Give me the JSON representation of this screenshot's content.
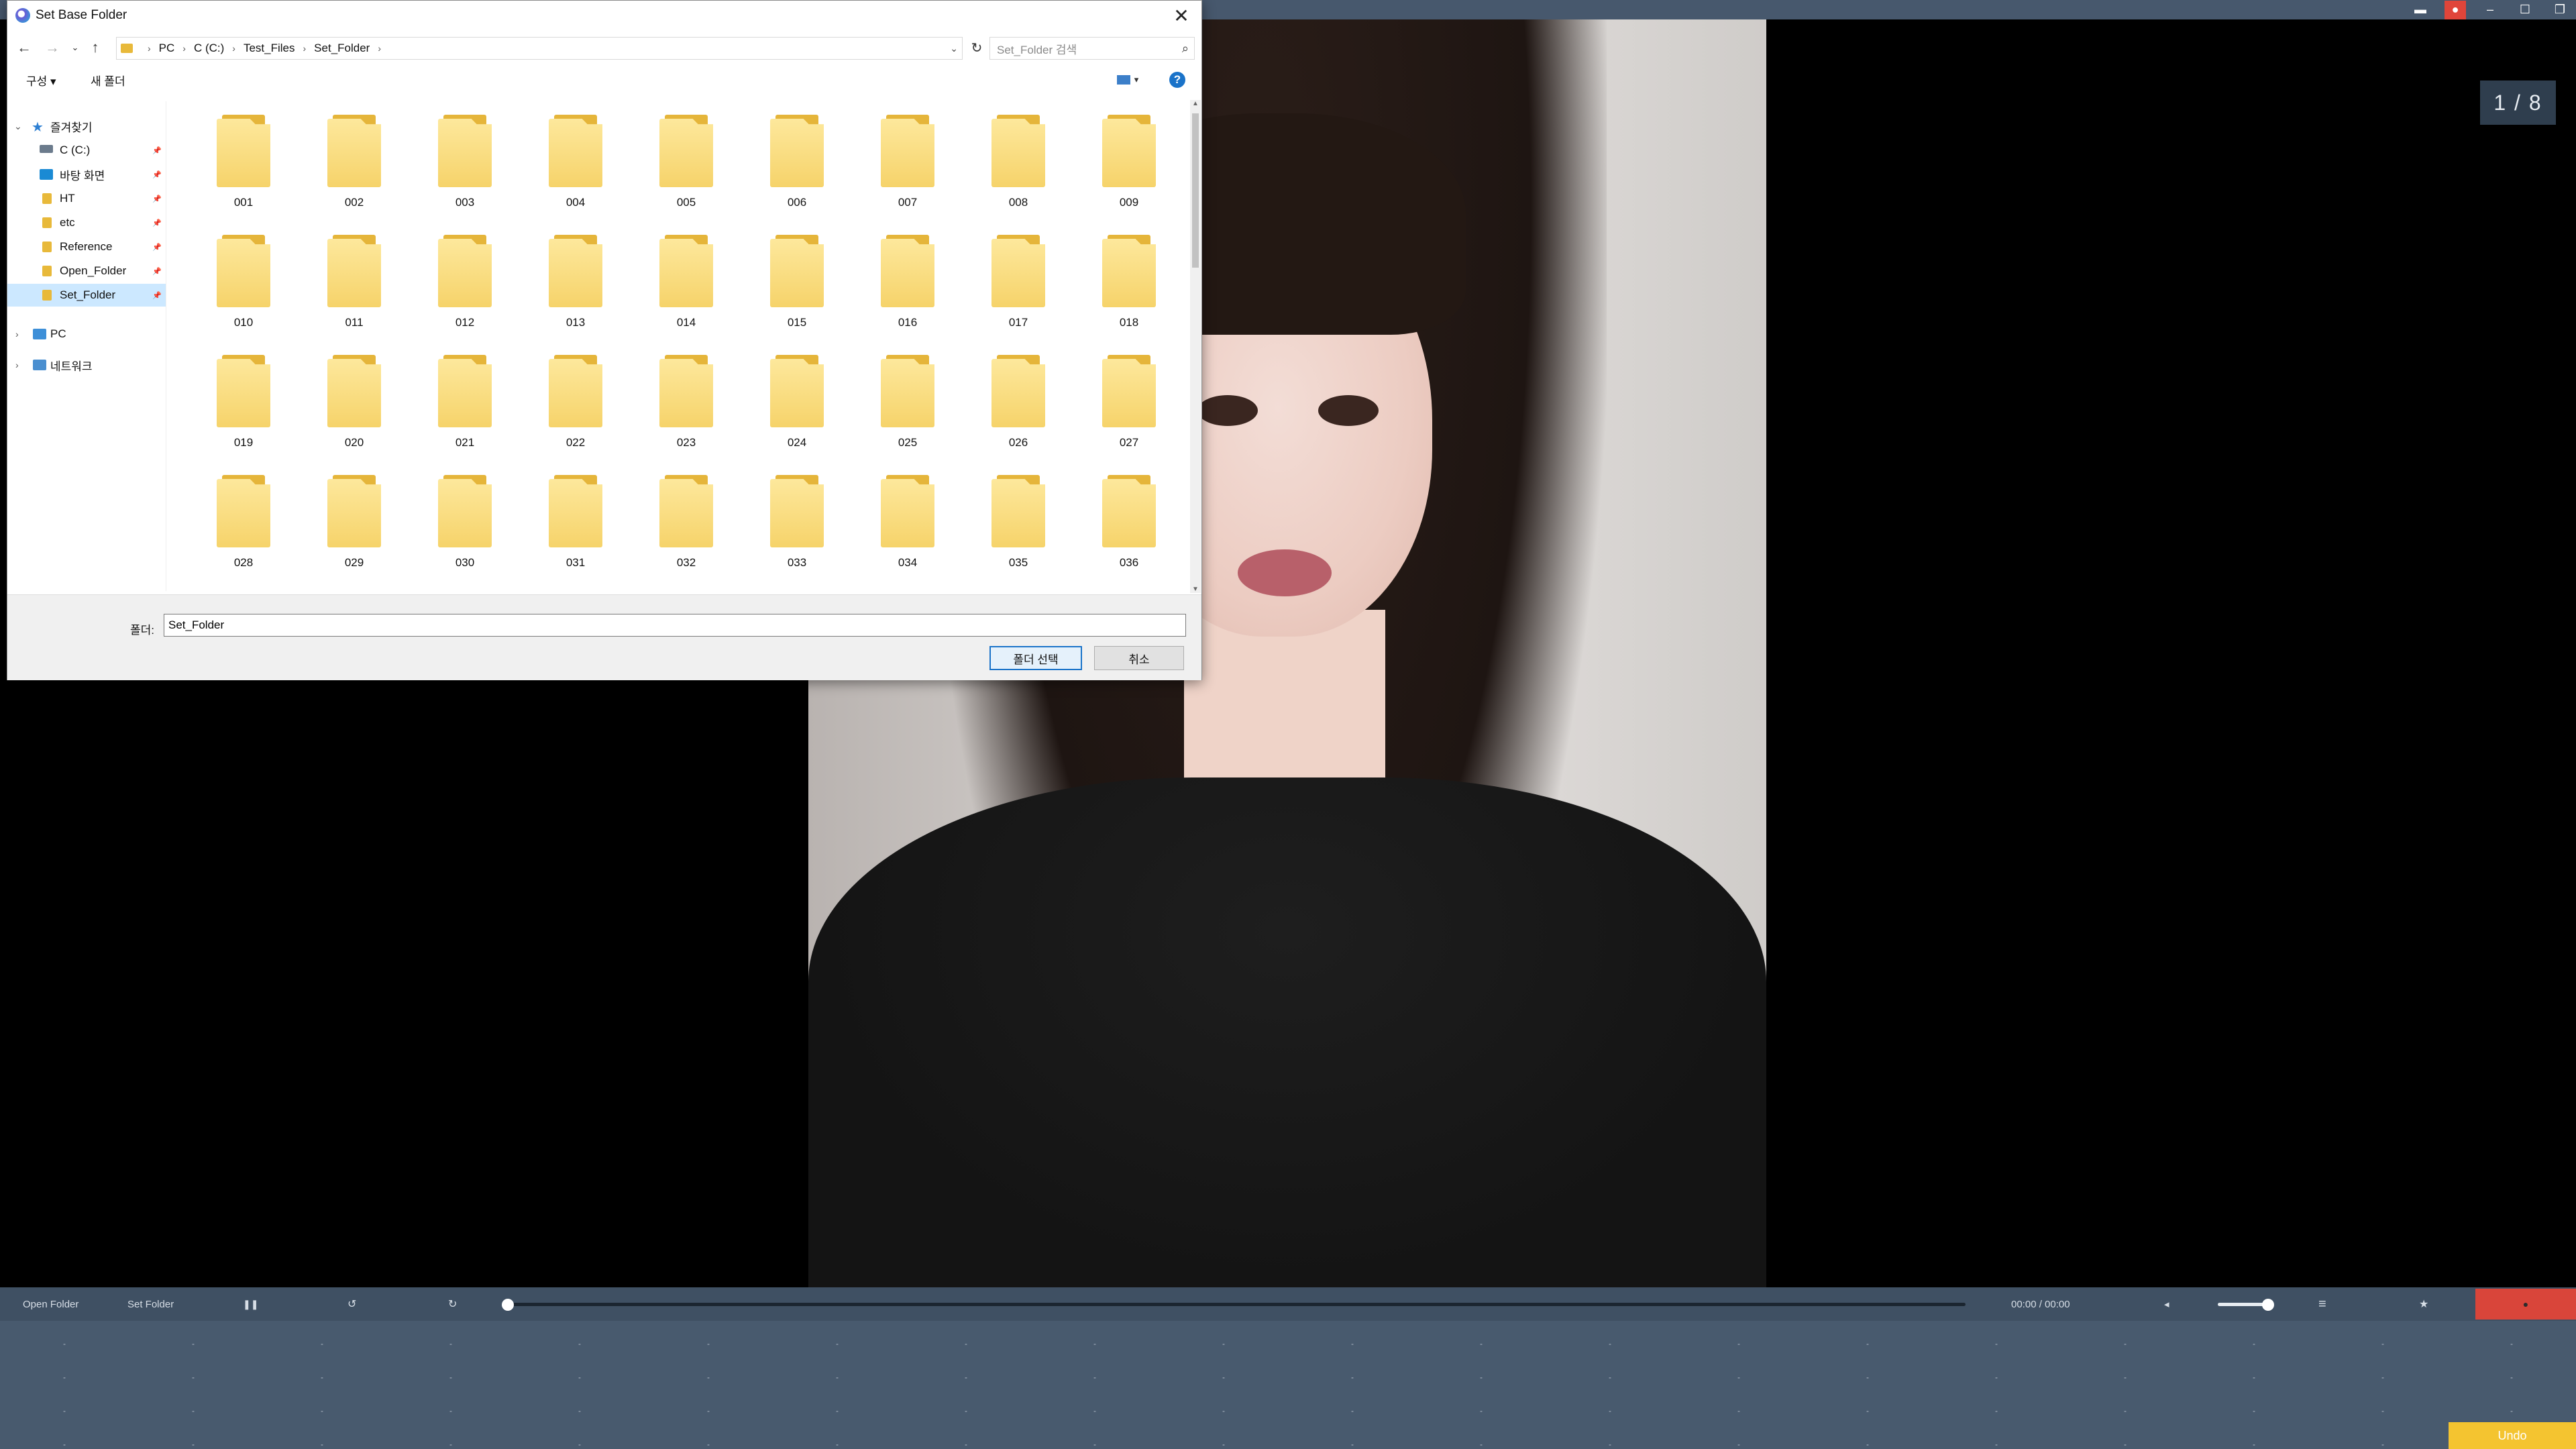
{
  "dialog": {
    "title": "Set Base Folder",
    "breadcrumb": [
      "PC",
      "C (C:)",
      "Test_Files",
      "Set_Folder"
    ],
    "search_placeholder": "Set_Folder 검색",
    "commands": {
      "organize": "구성 ▾",
      "new_folder": "새 폴더"
    },
    "nav": {
      "favorites": "즐겨찾기",
      "items": [
        {
          "label": "C (C:)",
          "icon": "drive-icon"
        },
        {
          "label": "바탕 화면",
          "icon": "desktop-icon"
        },
        {
          "label": "HT",
          "icon": "folder-icon"
        },
        {
          "label": "etc",
          "icon": "folder-icon"
        },
        {
          "label": "Reference",
          "icon": "folder-icon"
        },
        {
          "label": "Open_Folder",
          "icon": "folder-icon"
        },
        {
          "label": "Set_Folder",
          "icon": "folder-icon",
          "selected": true
        }
      ],
      "pc": "PC",
      "network": "네트워크"
    },
    "folders": [
      "001",
      "002",
      "003",
      "004",
      "005",
      "006",
      "007",
      "008",
      "009",
      "010",
      "011",
      "012",
      "013",
      "014",
      "015",
      "016",
      "017",
      "018",
      "019",
      "020",
      "021",
      "022",
      "023",
      "024",
      "025",
      "026",
      "027",
      "028",
      "029",
      "030",
      "031",
      "032",
      "033",
      "034",
      "035",
      "036"
    ],
    "footer": {
      "folder_label": "폴더:",
      "folder_value": "Set_Folder",
      "ok": "폴더 선택",
      "cancel": "취소"
    }
  },
  "viewer": {
    "counter": "1 / 8",
    "controls": {
      "open_folder": "Open Folder",
      "set_folder": "Set Folder",
      "pause": "❚❚",
      "rotate_left": "↺",
      "rotate_right": "↻",
      "time": "00:00 / 00:00",
      "mute_icon": "◂",
      "menu_icon": "≡",
      "star_icon": "★"
    },
    "progress": 0,
    "volume": 0.85,
    "undo": "Undo"
  },
  "colors": {
    "top_bar": "#47586d",
    "bottom_bar": "#485a6e",
    "accent_red": "#d9453a",
    "undo_yellow": "#f4c430",
    "selection": "#cce8ff",
    "folder_yellow": "#f6d36a"
  }
}
